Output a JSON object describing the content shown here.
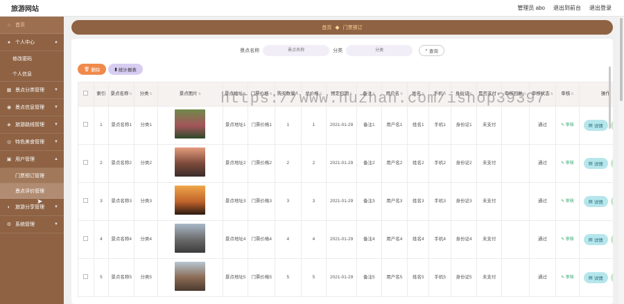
{
  "app": {
    "title": "旅游网站",
    "top_links": [
      "管理员 abo",
      "退出到前台",
      "退出登录"
    ]
  },
  "sidebar": {
    "home": "首页",
    "groups": [
      {
        "label": "个人中心",
        "icon": "user-icon",
        "children": [
          "修改密码",
          "个人信息"
        ]
      },
      {
        "label": "景点分类管理",
        "icon": "grid-icon",
        "children": []
      },
      {
        "label": "景点信息管理",
        "icon": "location-icon",
        "children": []
      },
      {
        "label": "旅游路线管理",
        "icon": "route-icon",
        "children": []
      },
      {
        "label": "特色美食管理",
        "icon": "food-icon",
        "children": []
      },
      {
        "label": "用户管理",
        "icon": "users-icon",
        "children": [
          "门票预订管理",
          "景点评价管理"
        ]
      },
      {
        "label": "旅游分享管理",
        "icon": "share-icon",
        "children": []
      },
      {
        "label": "系统管理",
        "icon": "settings-icon",
        "children": []
      }
    ],
    "selected_child": "景点评价管理"
  },
  "breadcrumb": {
    "home": "首页",
    "current": "门票预订"
  },
  "search": {
    "name_label": "景点名称",
    "name_placeholder": "景点名称",
    "category_label": "分类",
    "category_placeholder": "分类",
    "button": "查询"
  },
  "toolbar": {
    "delete": "删除",
    "stats": "统计报表"
  },
  "watermark": "https://www.huzhan.com/ishop39397",
  "table": {
    "columns": [
      "索引",
      "景点名称",
      "分类",
      "景点图片",
      "景点地址",
      "门票价格",
      "购买数量",
      "总价格",
      "预定日期",
      "备注",
      "用户名",
      "姓名",
      "手机",
      "身份证",
      "是否支付",
      "审核回复",
      "审核状态",
      "审核",
      "操作"
    ],
    "rows": [
      {
        "index": "1",
        "name": "景点名称1",
        "category": "分类1",
        "address": "景点地址1",
        "price": "门票价格1",
        "qty": "1",
        "total": "1",
        "date": "2021-01-29",
        "note": "备注1",
        "user": "用户名1",
        "real_name": "姓名1",
        "phone": "手机1",
        "id_card": "身份证1",
        "paid": "未支付",
        "reply": "",
        "status": "通过",
        "audit": "审核",
        "detail": "详情",
        "edit": "修",
        "img_colors": [
          "#6f8a4a",
          "#a4555a",
          "#2d4a2a"
        ]
      },
      {
        "index": "2",
        "name": "景点名称2",
        "category": "分类2",
        "address": "景点地址2",
        "price": "门票价格2",
        "qty": "2",
        "total": "2",
        "date": "2021-01-29",
        "note": "备注2",
        "user": "用户名2",
        "real_name": "姓名2",
        "phone": "手机2",
        "id_card": "身份证2",
        "paid": "未支付",
        "reply": "",
        "status": "通过",
        "audit": "审核",
        "detail": "详情",
        "edit": "修",
        "img_colors": [
          "#e59b7d",
          "#7c4a3a",
          "#3a2c2a"
        ]
      },
      {
        "index": "3",
        "name": "景点名称3",
        "category": "分类3",
        "address": "景点地址3",
        "price": "门票价格3",
        "qty": "3",
        "total": "3",
        "date": "2021-01-29",
        "note": "备注3",
        "user": "用户名3",
        "real_name": "姓名3",
        "phone": "手机3",
        "id_card": "身份证3",
        "paid": "未支付",
        "reply": "",
        "status": "通过",
        "audit": "审核",
        "detail": "详情",
        "edit": "修",
        "img_colors": [
          "#f0a64a",
          "#c0632a",
          "#2a1a12"
        ]
      },
      {
        "index": "4",
        "name": "景点名称4",
        "category": "分类4",
        "address": "景点地址4",
        "price": "门票价格4",
        "qty": "4",
        "total": "4",
        "date": "2021-01-29",
        "note": "备注4",
        "user": "用户名4",
        "real_name": "姓名4",
        "phone": "手机4",
        "id_card": "身份证4",
        "paid": "未支付",
        "reply": "",
        "status": "通过",
        "audit": "审核",
        "detail": "详情",
        "edit": "修",
        "img_colors": [
          "#a9b8c8",
          "#6a6a6a",
          "#3c3c3c"
        ]
      },
      {
        "index": "5",
        "name": "景点名称5",
        "category": "分类5",
        "address": "景点地址5",
        "price": "门票价格5",
        "qty": "5",
        "total": "5",
        "date": "2021-01-29",
        "note": "备注5",
        "user": "用户名5",
        "real_name": "姓名5",
        "phone": "手机5",
        "id_card": "身份证5",
        "paid": "未支付",
        "reply": "",
        "status": "通过",
        "audit": "审核",
        "detail": "详情",
        "edit": "修",
        "img_colors": [
          "#b7c6d2",
          "#8a6a52",
          "#4a3a30"
        ]
      }
    ]
  }
}
